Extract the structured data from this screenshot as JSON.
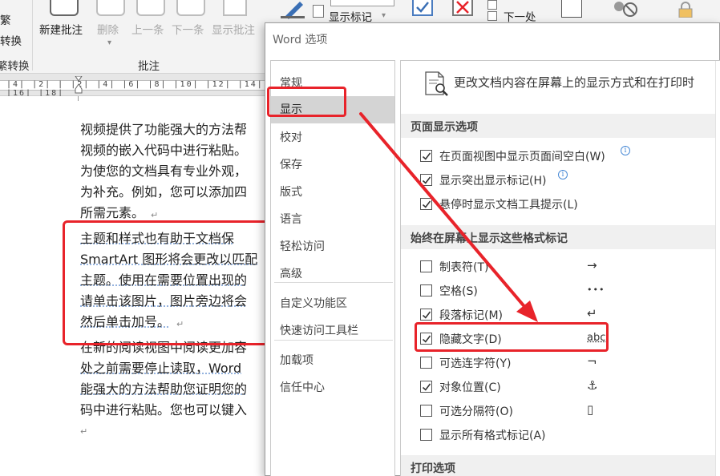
{
  "ribbon": {
    "traditional": "繁",
    "convert": "转换",
    "convert_group": "繁转换",
    "new_comment": "新建批注",
    "delete": "删除",
    "previous": "上一条",
    "next": "下一条",
    "show_comments": "显示批注",
    "comments_group": "批注",
    "show_markup": "显示标记",
    "next_item": "下一处"
  },
  "ruler": {
    "ticks": "|4| |2| |  |2| |4| |6| |8| |10| |12| |14| |16| |18|"
  },
  "document": {
    "lines": [
      "视频提供了功能强大的方法帮",
      "视频的嵌入代码中进行粘贴。",
      "为使您的文档具有专业外观，",
      "为补充。例如，您可以添加四",
      "所需元素。",
      "主题和样式也有助于文档保",
      "SmartArt 图形将会更改以匹配",
      "主题。使用在需要位置出现的",
      "请单击该图片，图片旁边将会",
      "然后单击加号。",
      "在新的阅读视图中阅读更加容",
      "处之前需要停止读取，Word",
      "能强大的方法帮助您证明您的",
      "码中进行粘贴。您也可以键入"
    ],
    "paragraph_mark": "↵"
  },
  "dialog": {
    "title": "Word 选项",
    "nav": [
      "常规",
      "显示",
      "校对",
      "保存",
      "版式",
      "语言",
      "轻松访问",
      "高级",
      "自定义功能区",
      "快速访问工具栏",
      "加载项",
      "信任中心"
    ],
    "selected_nav": "显示",
    "header": "更改文档内容在屏幕上的显示方式和在打印时",
    "section_page": "页面显示选项",
    "page_options": [
      {
        "label": "在页面视图中显示页面间空白(W)",
        "checked": true,
        "info": true
      },
      {
        "label": "显示突出显示标记(H)",
        "checked": true,
        "info": true
      },
      {
        "label": "悬停时显示文档工具提示(L)",
        "checked": true,
        "info": false
      }
    ],
    "section_marks": "始终在屏幕上显示这些格式标记",
    "mark_options": [
      {
        "label": "制表符(T)",
        "checked": false,
        "symbol": "→"
      },
      {
        "label": "空格(S)",
        "checked": false,
        "symbol": "•••"
      },
      {
        "label": "段落标记(M)",
        "checked": true,
        "symbol": "↵"
      },
      {
        "label": "隐藏文字(D)",
        "checked": true,
        "symbol": "abc"
      },
      {
        "label": "可选连字符(Y)",
        "checked": false,
        "symbol": "¬"
      },
      {
        "label": "对象位置(C)",
        "checked": true,
        "symbol": "⚓"
      },
      {
        "label": "可选分隔符(O)",
        "checked": false,
        "symbol": "▯"
      },
      {
        "label": "显示所有格式标记(A)",
        "checked": false,
        "symbol": ""
      }
    ],
    "section_print": "打印选项",
    "info_glyph": "i"
  },
  "colors": {
    "annotation_red": "#e8232a",
    "nav_selected": "#d4d4d4",
    "section_bg": "#f0f0f0"
  }
}
